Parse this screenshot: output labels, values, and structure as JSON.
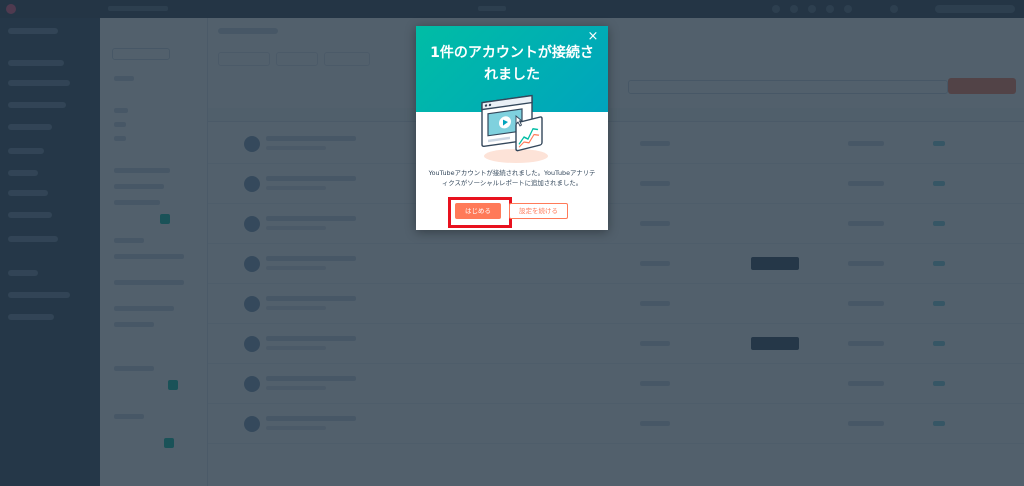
{
  "modal": {
    "title_line1": "1件のアカウントが接続さ",
    "title_line2": "れました",
    "close_label": "×",
    "body_line1": "YouTubeアカウントが接続されました。YouTubeアナリテ",
    "body_line2": "ィクスがソーシャルレポートに追加されました。",
    "primary_button": "はじめる",
    "secondary_button": "設定を続ける"
  },
  "colors": {
    "accent": "#ff7a59",
    "header_teal": "#00bda5",
    "highlight_red": "#e8111e",
    "sidebar": "#33475b"
  },
  "icons": {
    "close": "close-icon",
    "illustration": "video-analytics-illustration"
  }
}
